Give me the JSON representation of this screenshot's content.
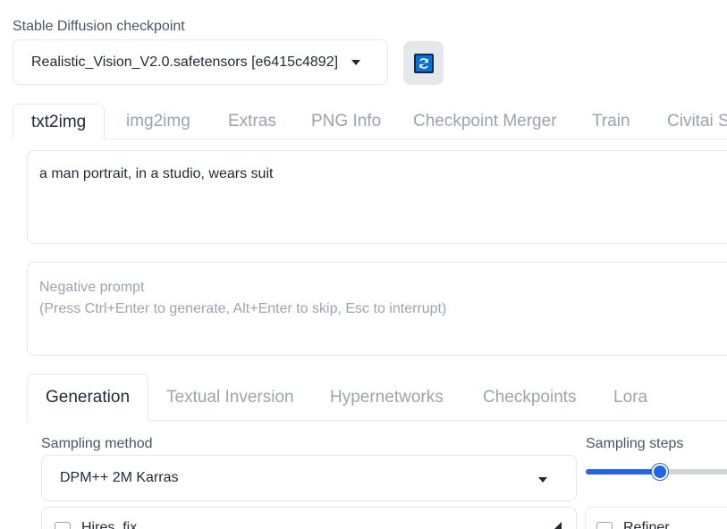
{
  "checkpoint": {
    "label": "Stable Diffusion checkpoint",
    "value": "Realistic_Vision_V2.0.safetensors [e6415c4892]"
  },
  "tabs": [
    "txt2img",
    "img2img",
    "Extras",
    "PNG Info",
    "Checkpoint Merger",
    "Train",
    "Civitai S"
  ],
  "prompt": {
    "value": "a man portrait, in a studio, wears suit",
    "negative_placeholder_line1": "Negative prompt",
    "negative_placeholder_line2": "(Press Ctrl+Enter to generate, Alt+Enter to skip, Esc to interrupt)"
  },
  "subtabs": [
    "Generation",
    "Textual Inversion",
    "Hypernetworks",
    "Checkpoints",
    "Lora"
  ],
  "sampling": {
    "method_label": "Sampling method",
    "method_value": "DPM++ 2M Karras",
    "steps_label": "Sampling steps",
    "steps_fraction": 0.49
  },
  "hires": {
    "label": "Hires. fix"
  },
  "refiner": {
    "label": "Refiner"
  },
  "colors": {
    "accent": "#2563eb",
    "refresh_icon": "#0a6fd6"
  }
}
